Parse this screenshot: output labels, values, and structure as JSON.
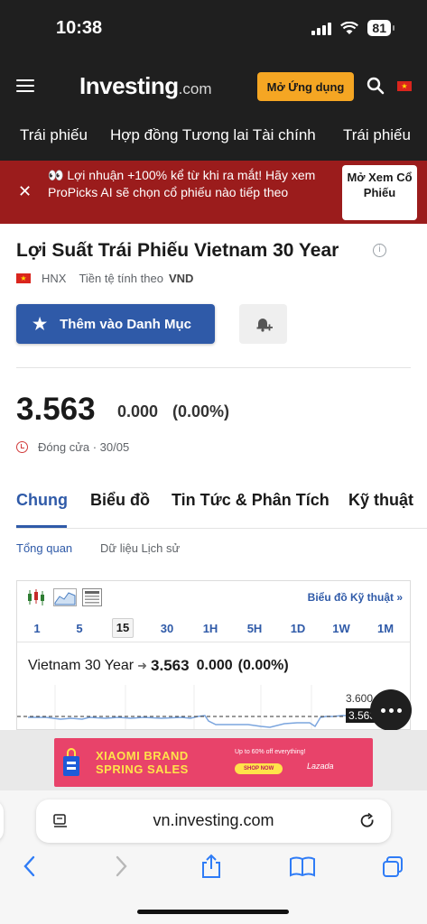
{
  "status_bar": {
    "time": "10:38",
    "battery": "81"
  },
  "header": {
    "logo_main": "Investing",
    "logo_suffix": ".com",
    "open_app_label": "Mở Ứng dụng"
  },
  "nav": {
    "items": [
      "Trái phiếu",
      "Hợp đồng Tương lai Tài chính",
      "Trái phiếu"
    ]
  },
  "promo": {
    "text": "👀 Lợi nhuận +100% kể từ khi ra mắt! Hãy xem ProPicks AI sẽ chọn cổ phiếu nào tiếp theo",
    "cta": "Mở Xem Cổ Phiếu",
    "close": "✕"
  },
  "instrument": {
    "title": "Lợi Suất Trái Phiếu Vietnam 30 Year",
    "exchange": "HNX",
    "currency_label": "Tiền tệ tính theo",
    "currency": "VND",
    "watchlist_label": "Thêm vào Danh Mục",
    "price": "3.563",
    "change": "0.000",
    "change_pct": "(0.00%)",
    "close_status": "Đóng cửa · 30/05"
  },
  "tabs": [
    "Chung",
    "Biểu đồ",
    "Tin Tức & Phân Tích",
    "Kỹ thuật"
  ],
  "subtabs": [
    "Tổng quan",
    "Dữ liệu Lịch sử"
  ],
  "chart_widget": {
    "tech_link": "Biểu đồ Kỹ thuật »",
    "intervals": [
      "1",
      "5",
      "15",
      "30",
      "1H",
      "5H",
      "1D",
      "1W",
      "1M"
    ],
    "active_interval": "15",
    "name": "Vietnam 30 Year",
    "price": "3.563",
    "change": "0.000",
    "change_pct": "(0.00%)",
    "axis_top": "3.600",
    "axis_current": "3.563"
  },
  "ad": {
    "title_line1": "XIAOMI BRAND",
    "title_line2": "SPRING SALES",
    "subtitle": "Up to 60% off everything!",
    "shop": "SHOP NOW",
    "brand": "Lazada"
  },
  "browser": {
    "url": "vn.investing.com"
  },
  "colors": {
    "accent": "#2f5aa8",
    "cta_orange": "#f5a623",
    "promo_red": "#9b1c1c",
    "header_dark": "#1f1f1f"
  }
}
